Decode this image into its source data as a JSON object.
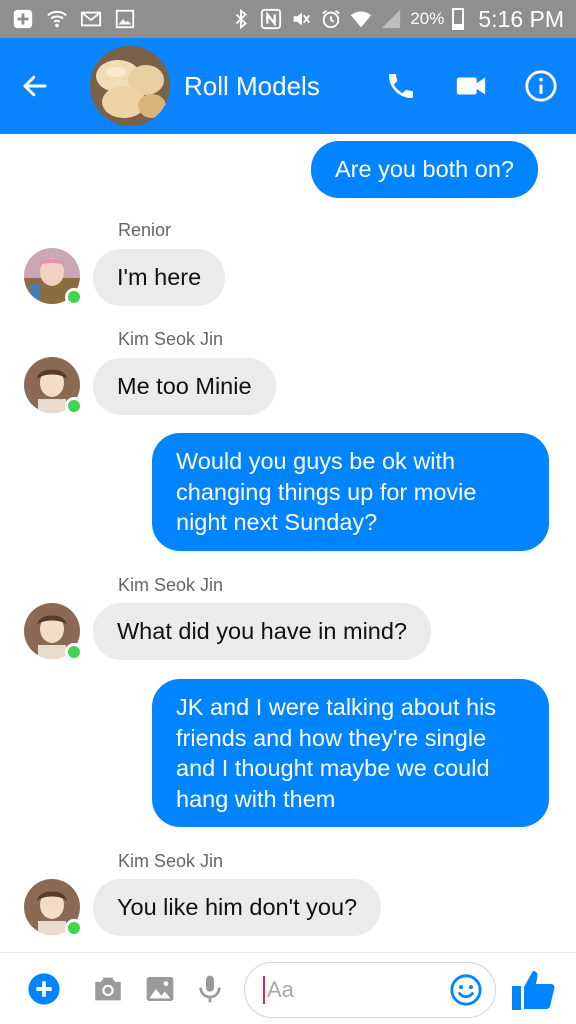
{
  "status_bar": {
    "battery": "20%",
    "time": "5:16 PM",
    "icons": [
      "add-icon",
      "wifi-call-icon",
      "mail-icon",
      "image-icon",
      "bluetooth-icon",
      "nfc-icon",
      "mute-icon",
      "alarm-icon",
      "wifi-icon",
      "signal-icon",
      "battery-icon"
    ]
  },
  "header": {
    "title": "Roll Models",
    "back_icon": "arrow-left-icon",
    "actions": [
      "phone-icon",
      "video-icon",
      "info-icon"
    ]
  },
  "messages": [
    {
      "direction": "out",
      "text": "Are you both on?"
    },
    {
      "direction": "in",
      "sender": "Renior",
      "text": "I'm here"
    },
    {
      "direction": "in",
      "sender": "Kim Seok Jin",
      "text": "Me too Minie"
    },
    {
      "direction": "out",
      "text": "Would you guys be ok with changing things up for movie night next Sunday?"
    },
    {
      "direction": "in",
      "sender": "Kim Seok Jin",
      "text": "What did you have in mind?"
    },
    {
      "direction": "out",
      "text": "JK and I were talking about his friends and how they're single and I thought maybe we could hang with them"
    },
    {
      "direction": "in",
      "sender": "Kim Seok Jin",
      "text": "You like him don't you?"
    }
  ],
  "composer": {
    "placeholder": "Aa",
    "icons": [
      "plus-icon",
      "camera-icon",
      "gallery-icon",
      "mic-icon",
      "emoji-icon",
      "thumbs-up-icon"
    ]
  },
  "colors": {
    "accent": "#0084ff",
    "header": "#0a84ff",
    "status_bar": "#8f8f8f",
    "incoming_bubble": "#ebebeb",
    "online": "#3dd64e"
  }
}
